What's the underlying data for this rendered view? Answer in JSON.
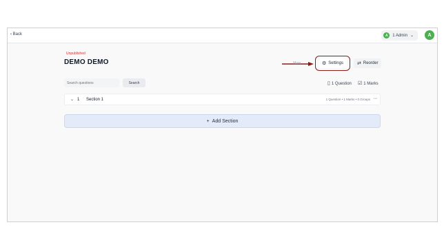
{
  "topbar": {
    "back_label": "Back",
    "admin_avatar": "A",
    "admin_label": "1 Admin",
    "user_avatar": "A"
  },
  "test": {
    "status": "Unpublished",
    "title": "DEMO DEMO"
  },
  "toolbar": {
    "more_label": "More",
    "settings_label": "Settings",
    "reorder_label": "Reorder"
  },
  "search": {
    "placeholder": "Search questions",
    "button_label": "Search"
  },
  "summary": {
    "questions": "1 Question",
    "marks": "1 Marks"
  },
  "sections": [
    {
      "number": "1",
      "name": "Section 1",
      "stats": "1 Question  •  1 Marks  •  0 Groups"
    }
  ],
  "add_section_label": "Add Section",
  "colors": {
    "accent_red": "#8b1a1a",
    "status_red": "#d32f2f",
    "avatar_green": "#4caf50",
    "add_section_bg": "#e3ebf9"
  },
  "icons": [
    "chevron-left-icon",
    "chevron-down-icon",
    "gear-icon",
    "reorder-icon",
    "book-icon",
    "checkbox-icon",
    "more-horizontal-icon",
    "plus-icon",
    "arrow-right-icon"
  ]
}
